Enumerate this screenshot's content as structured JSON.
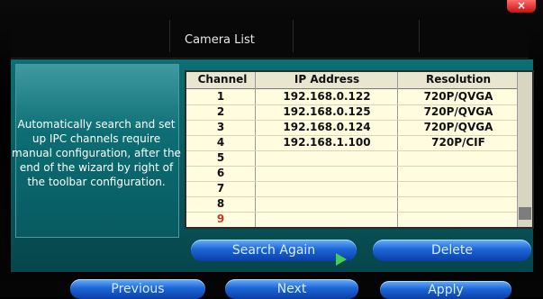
{
  "window": {
    "title": "Camera List",
    "close_label": "×"
  },
  "description": "Automatically search and set up IPC channels require manual configuration, after the end of the wizard by right of the toolbar configuration.",
  "table": {
    "headers": [
      "Channel",
      "IP Address",
      "Resolution"
    ],
    "rows": [
      [
        "1",
        "192.168.0.122",
        "720P/QVGA"
      ],
      [
        "2",
        "192.168.0.125",
        "720P/QVGA"
      ],
      [
        "3",
        "192.168.0.124",
        "720P/QVGA"
      ],
      [
        "4",
        "192.168.1.100",
        "720P/CIF"
      ],
      [
        "5",
        "",
        ""
      ],
      [
        "6",
        "",
        ""
      ],
      [
        "7",
        "",
        ""
      ],
      [
        "8",
        "",
        ""
      ],
      [
        "9",
        "",
        ""
      ]
    ],
    "highlight_color": "#c0392b"
  },
  "actions": {
    "search_again": "Search Again",
    "delete": "Delete"
  },
  "nav": {
    "previous": "Previous",
    "next": "Next",
    "apply": "Apply"
  }
}
